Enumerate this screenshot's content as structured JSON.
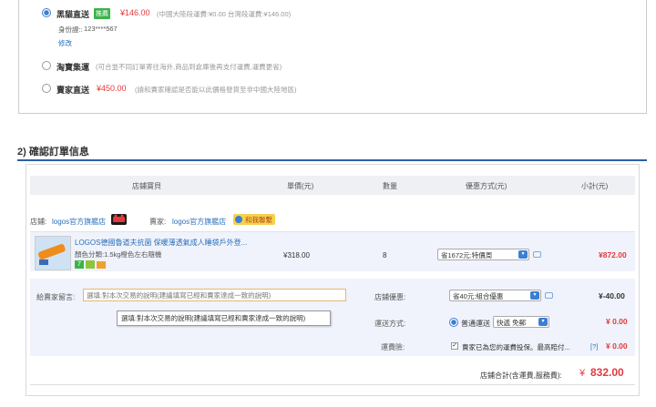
{
  "shipping": {
    "option1": {
      "name": "黑貓直送",
      "badge": "推薦",
      "price": "¥146.00",
      "note": "(中國大陸段運費:¥0.00 台灣段運費:¥146.00)",
      "id_label": "身份證::",
      "id_value": "123****567",
      "edit_link": "修改"
    },
    "option2": {
      "name": "淘寶集運",
      "note": "(可合並不同訂單寄往海外,商品到倉庫後再支付運費,運費更省)"
    },
    "option3": {
      "name": "賣家直送",
      "price": "¥450.00",
      "note": "(請和賣家確認是否能以此價格發貨至非中國大陸地區)"
    }
  },
  "section": {
    "title": "2) 確認訂單信息"
  },
  "table_headers": [
    "店鋪寶貝",
    "單價(元)",
    "數量",
    "優惠方式(元)",
    "小計(元)"
  ],
  "shop": {
    "shop_label": "店鋪:",
    "shop_name": "logos官方旗艦店",
    "seller_label": "賣家:",
    "seller_name": "logos官方旗艦店",
    "contact": "和我聯繫"
  },
  "product": {
    "title": "LOGOS德國魯道夫抗菌 保暖薄透氣成人睡袋戶外登...",
    "spec": "顏色分類:1.5kg橙色左右隨機",
    "unit_price": "¥318.00",
    "quantity": "8",
    "discount_select": "省1672元:特價周",
    "subtotal": "¥872.00"
  },
  "extra": {
    "message_label": "給賣家留言:",
    "message_placeholder": "選填:對本次交易的說明(建議填寫已經和賣家達成一致的說明)",
    "tooltip": "選填:對本次交易的說明(建議填寫已經和賣家達成一致的說明)",
    "shop_discount_label": "店鋪優惠:",
    "shop_discount_select": "省40元:組合優惠",
    "shop_discount_value": "¥-40.00",
    "delivery_label": "運送方式:",
    "delivery_name": "普通運送",
    "delivery_select": "快遞 免郵",
    "delivery_value": "¥ 0.00",
    "insurance_label": "運費險:",
    "insurance_text": "賣家已為您的運費投保。最高賠付...",
    "insurance_help": "[?]",
    "insurance_value": "¥ 0.00"
  },
  "total": {
    "label": "店鋪合計(含運費,服務費):",
    "currency": "¥",
    "value": "832.00"
  },
  "colors": {
    "accent": "#2e5fa8",
    "price_red": "#e4393c",
    "radio_blue": "#3a7fd5"
  }
}
